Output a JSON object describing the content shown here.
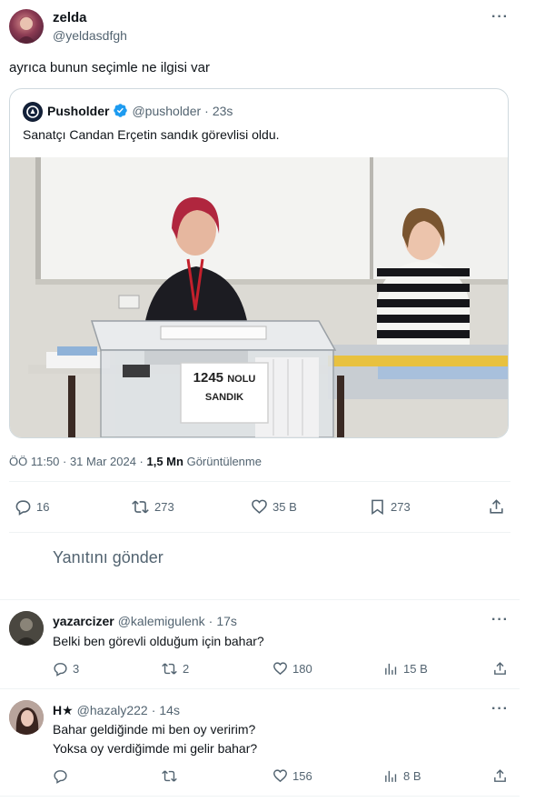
{
  "tweet": {
    "author_name": "zelda",
    "author_handle": "@yeldasdfgh",
    "text": "ayrıca bunun seçimle ne ilgisi var",
    "quoted": {
      "author_name": "Pusholder",
      "author_handle": "@pusholder",
      "dot": "·",
      "time": "23s",
      "text": "Sanatçı Candan Erçetin sandık görevlisi oldu.",
      "image": {
        "ballot_box_number": "1245",
        "ballot_box_suffix": "NOLU",
        "ballot_box_label": "SANDIK"
      }
    },
    "meta": {
      "time_date": "ÖÖ 11:50 · 31 Mar 2024 · ",
      "views": "1,5 Mn",
      "views_label": "Görüntülenme"
    },
    "actions": {
      "replies": "16",
      "reposts": "273",
      "likes": "35 B",
      "bookmarks": "273"
    }
  },
  "reply_box": {
    "placeholder": "Yanıtını gönder"
  },
  "replies": [
    {
      "author_name": "yazarcizer",
      "author_handle": "@kalemigulenk",
      "dot": "·",
      "time": "17s",
      "lines": [
        "Belki ben görevli olduğum için bahar?"
      ],
      "replies": "3",
      "reposts": "2",
      "likes": "180",
      "views": "15 B"
    },
    {
      "author_name": "H★",
      "author_handle": "@hazaly222",
      "dot": "·",
      "time": "14s",
      "lines": [
        "Bahar geldiğinde mi ben oy veririm?",
        "Yoksa oy verdiğimde mi gelir bahar?"
      ],
      "replies": "",
      "reposts": "",
      "likes": "156",
      "views": "8 B"
    }
  ],
  "colors": {
    "verified": "#1d9bf0",
    "text": "#0f1419",
    "muted": "#536471",
    "border": "#cfd9de",
    "divider": "#eff3f4"
  }
}
